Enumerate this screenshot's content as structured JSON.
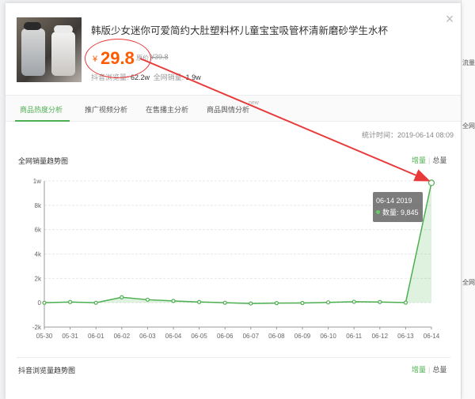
{
  "background": {
    "fragments": [
      "流量",
      "全网销",
      "全网"
    ]
  },
  "modal": {
    "close_icon": "close-icon",
    "product": {
      "title": "韩版少女迷你可爱简约大肚塑料杯儿童宝宝吸管杯清新磨砂学生水杯",
      "currency": "¥",
      "price": "29.8",
      "original_price_label": "原价：",
      "original_price": "¥39.8",
      "views_label": "抖音浏览量:",
      "views_value": "62.2w",
      "sales_label": "全网销量:",
      "sales_value": "1.9w"
    },
    "tabs": [
      {
        "label": "商品热度分析",
        "active": true
      },
      {
        "label": "推广视频分析",
        "active": false
      },
      {
        "label": "在售播主分析",
        "active": false
      },
      {
        "label": "商品舆情分析",
        "active": false
      }
    ],
    "tab_extra": "new",
    "stat_time": "统计时间：2019-06-14 08:09",
    "sales_section": {
      "title": "全网销量趋势图",
      "toggle_increment": "增量",
      "toggle_total": "总量"
    },
    "views_section": {
      "title": "抖音浏览量趋势图",
      "toggle_increment": "增量",
      "toggle_total": "总量"
    },
    "tooltip": {
      "date": "06-14 2019",
      "label": "数量: 9,845"
    }
  },
  "colors": {
    "accent": "#4caf50",
    "price": "#ff5a00",
    "annotation": "#e83a3a"
  },
  "chart_data": {
    "type": "area",
    "title": "全网销量趋势图",
    "categories": [
      "05-30",
      "05-31",
      "06-01",
      "06-02",
      "06-03",
      "06-04",
      "06-05",
      "06-06",
      "06-07",
      "06-08",
      "06-09",
      "06-10",
      "06-11",
      "06-12",
      "06-13",
      "06-14"
    ],
    "series": [
      {
        "values": [
          0,
          60,
          0,
          450,
          250,
          150,
          60,
          0,
          -60,
          -30,
          -20,
          30,
          80,
          60,
          10,
          9845
        ]
      }
    ],
    "yticks": [
      "-2k",
      "0",
      "2k",
      "4k",
      "6k",
      "8k",
      "1w"
    ],
    "ylim": [
      -2000,
      10000
    ],
    "grid": true
  }
}
